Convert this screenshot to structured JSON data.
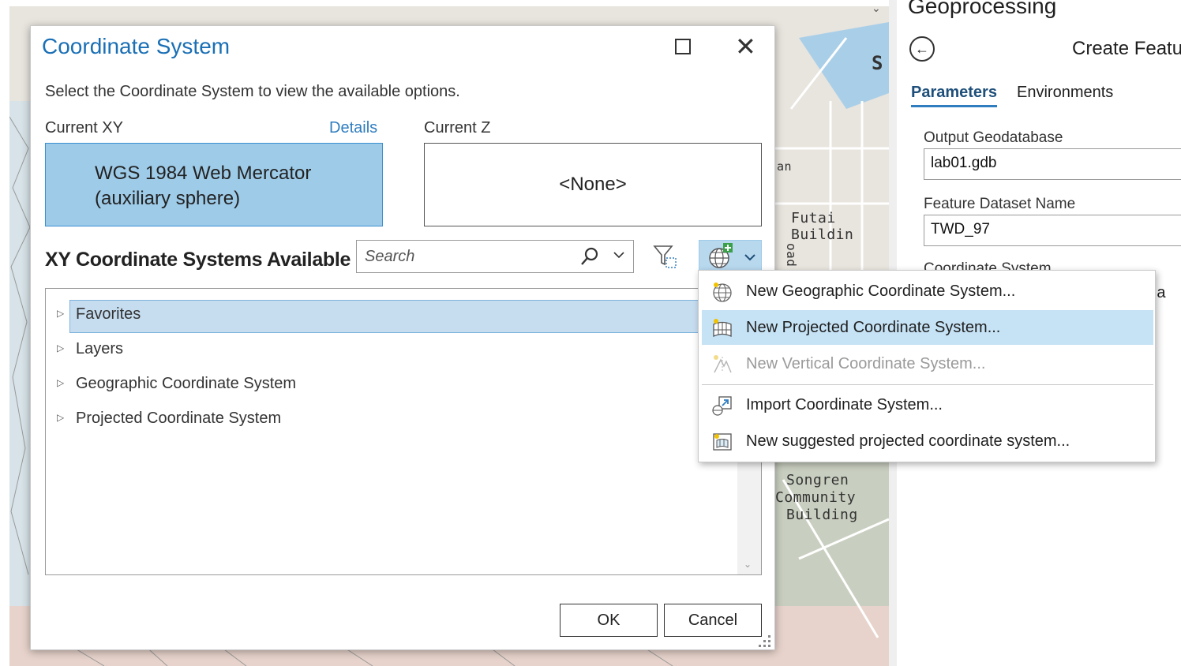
{
  "map": {
    "labels": [
      "Futai Buildin",
      "an",
      "oad",
      "Songren",
      "Community",
      "Building",
      "S"
    ]
  },
  "geoprocessing": {
    "title": "Geoprocessing",
    "tool_title": "Create Featu",
    "tabs": [
      "Parameters",
      "Environments"
    ],
    "output_gdb_label": "Output Geodatabase",
    "output_gdb_value": "lab01.gdb",
    "dataset_name_label": "Feature Dataset Name",
    "dataset_name_value": "TWD_97",
    "coord_label": "Coordinate System",
    "coord_stub": "ilia"
  },
  "dialog": {
    "title": "Coordinate System",
    "instruction": "Select the Coordinate System to view the available options.",
    "current_xy_label": "Current XY",
    "details_link": "Details",
    "current_z_label": "Current Z",
    "current_xy_line1": "WGS 1984 Web Mercator",
    "current_xy_line2": "(auxiliary sphere)",
    "current_z_value": "<None>",
    "available_label": "XY Coordinate Systems Available",
    "search_placeholder": "Search",
    "tree_items": [
      "Favorites",
      "Layers",
      "Geographic Coordinate System",
      "Projected Coordinate System"
    ],
    "ok_label": "OK",
    "cancel_label": "Cancel"
  },
  "menu": {
    "items": [
      {
        "label": "New Geographic Coordinate System...",
        "icon": "globe-icon"
      },
      {
        "label": "New Projected Coordinate System...",
        "icon": "projected-grid-icon"
      },
      {
        "label": "New Vertical Coordinate System...",
        "icon": "vertical-system-icon"
      },
      {
        "label": "Import Coordinate System...",
        "icon": "import-icon"
      },
      {
        "label": "New suggested projected coordinate system...",
        "icon": "suggested-projection-icon"
      }
    ]
  },
  "colors": {
    "accent": "#1a6fb5",
    "selection": "#c6ddf0",
    "current_xy_fill": "#9ecbe8",
    "menu_highlight": "#c6e2f5"
  }
}
